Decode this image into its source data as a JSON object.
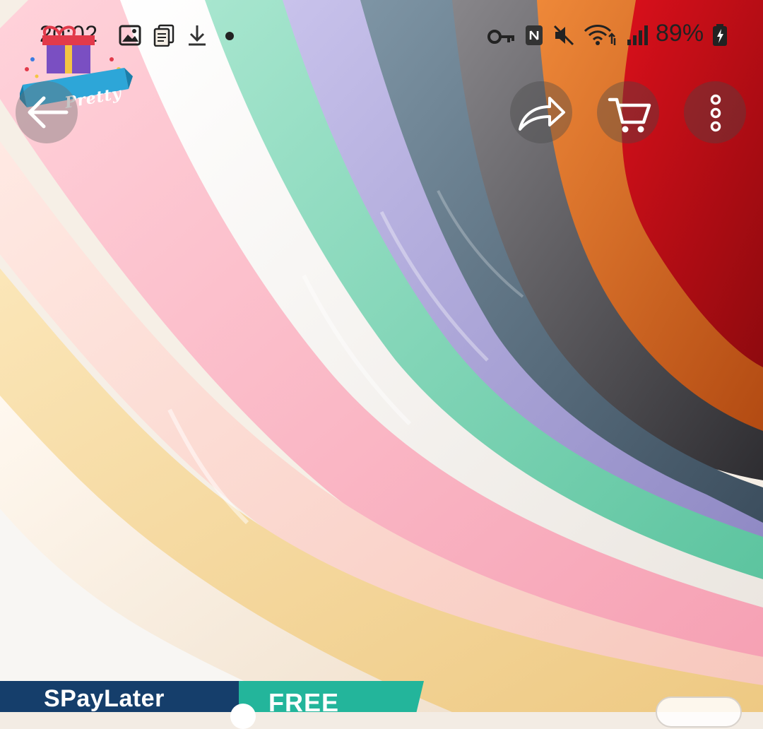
{
  "status_bar": {
    "time": "20:02",
    "battery": "89%",
    "icons": [
      "gallery-icon",
      "document-icon",
      "download-icon",
      "dot-icon",
      "vpn-key-icon",
      "nfc-icon",
      "mute-icon",
      "wifi-icon",
      "signal-icon",
      "battery-charging-icon"
    ]
  },
  "brand": {
    "logo_text": "Pretty"
  },
  "toolbar": {
    "back_icon": "back-arrow-icon",
    "share_icon": "share-icon",
    "cart_icon": "cart-icon",
    "more_icon": "more-vertical-icon"
  },
  "banner": {
    "spaylater": "SPayLater",
    "free": "FREE"
  },
  "colors": {
    "spaylater_bg": "#153e6b",
    "free_bg": "#23b59b",
    "overlay_button": "rgba(70,70,70,0.38)"
  }
}
